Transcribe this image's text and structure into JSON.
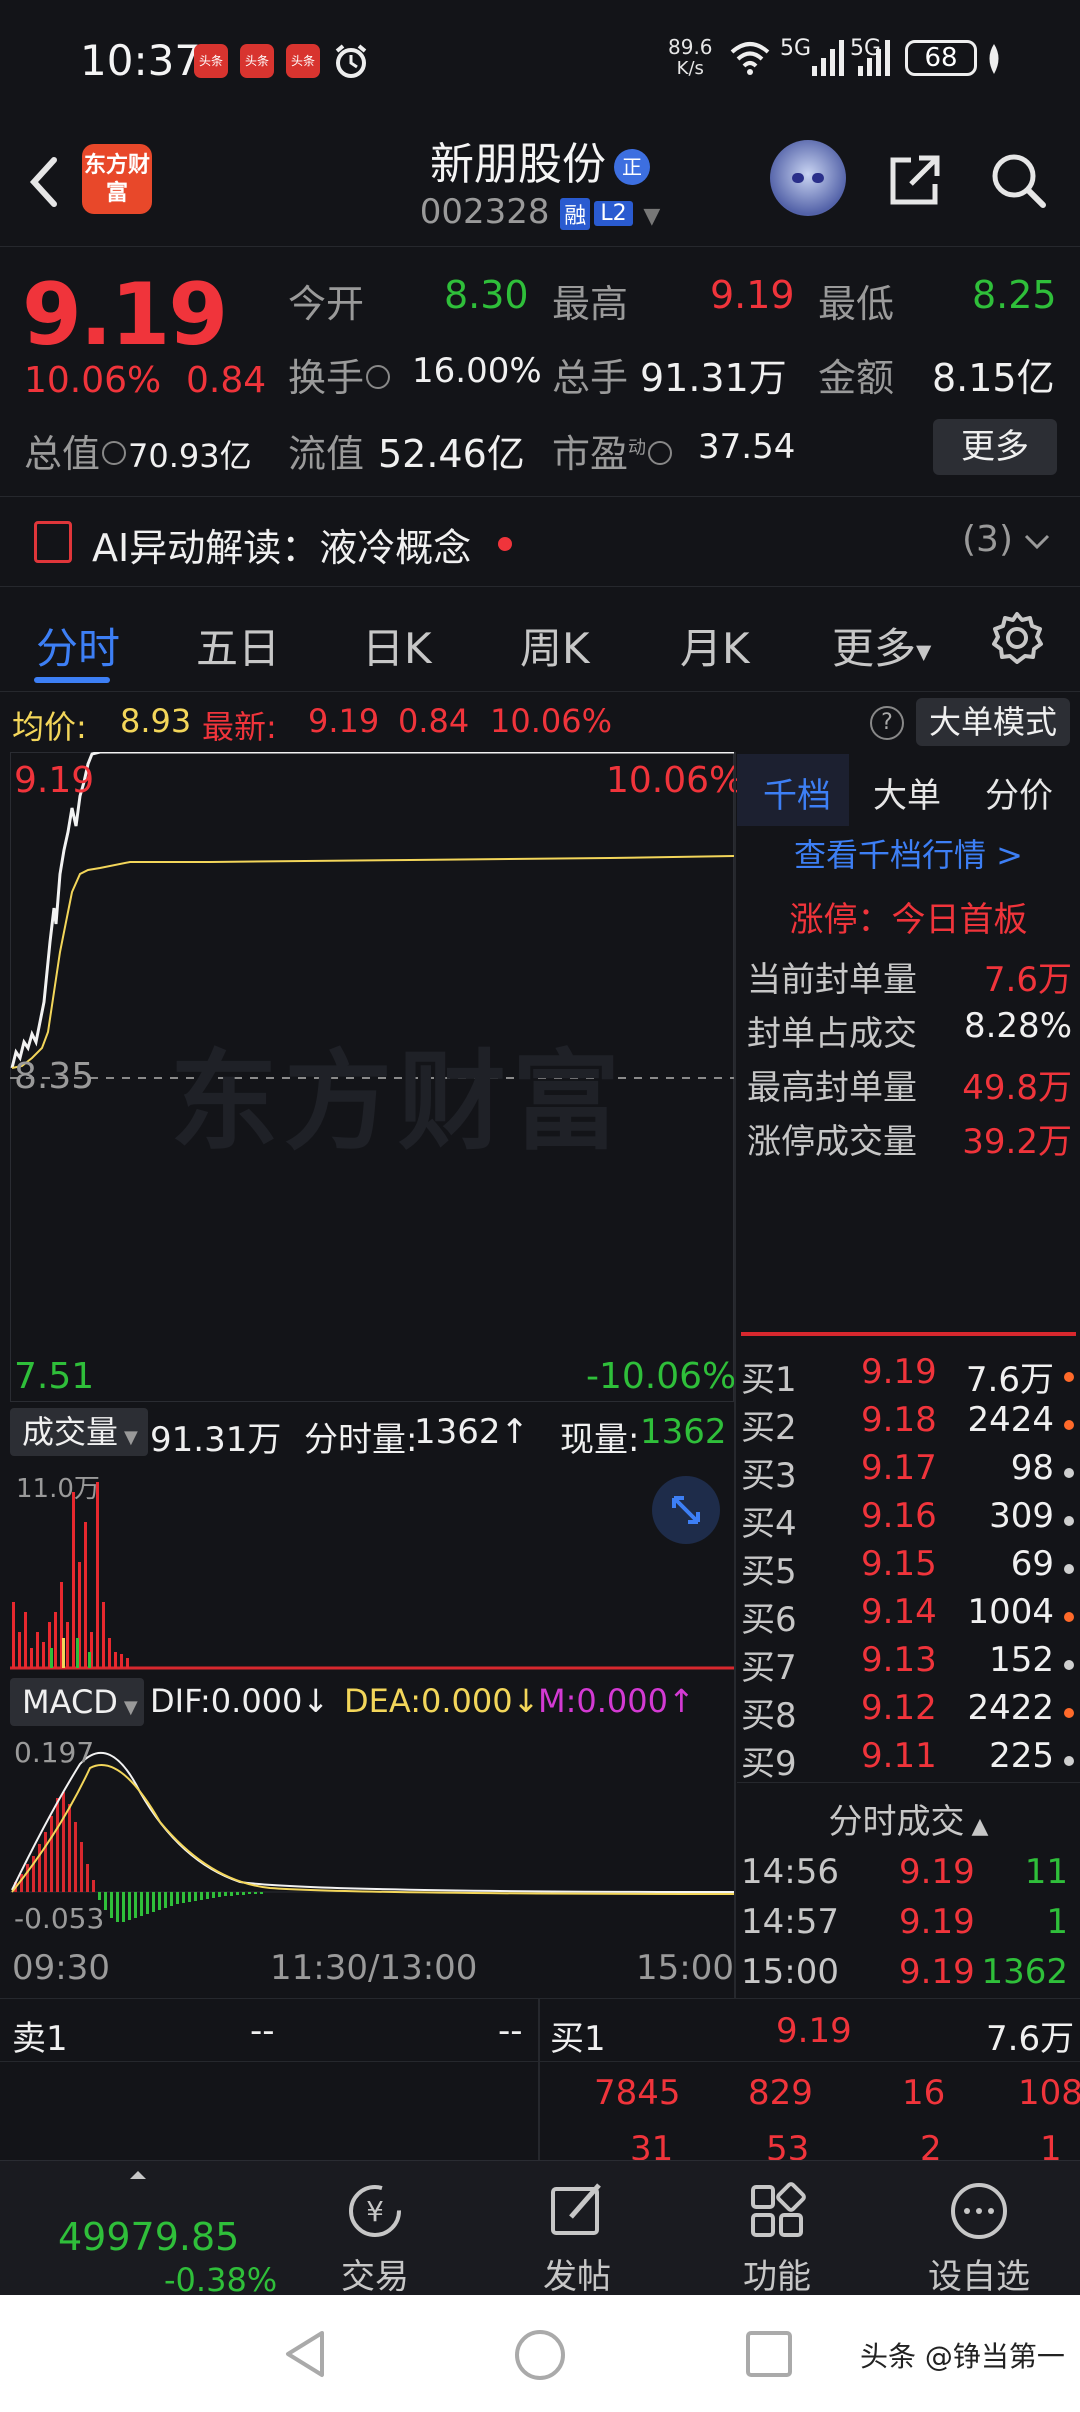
{
  "status_bar": {
    "time": "10:37",
    "app_icon_label": "头条",
    "net_speed": "89.6",
    "net_unit": "K/s",
    "signal1": "5G",
    "signal2": "5G",
    "battery": "68"
  },
  "header": {
    "logo_text": "东方财富",
    "stock_name": "新朋股份",
    "badge": "正",
    "stock_code": "002328",
    "tag_rong": "融",
    "tag_l2": "L2"
  },
  "quote": {
    "price": "9.19",
    "change_pct": "10.06%",
    "change": "0.84",
    "open_label": "今开",
    "open": "8.30",
    "high_label": "最高",
    "high": "9.19",
    "low_label": "最低",
    "low": "8.25",
    "turnover_label": "换手",
    "turnover": "16.00%",
    "volume_label": "总手",
    "volume": "91.31万",
    "amount_label": "金额",
    "amount": "8.15亿",
    "mktcap_label": "总值",
    "mktcap": "70.93亿",
    "float_label": "流值",
    "float": "52.46亿",
    "pe_label": "市盈",
    "pe_sup": "动",
    "pe": "37.54",
    "more": "更多"
  },
  "ai_row": {
    "text": "AI异动解读：液冷概念",
    "count": "(3)"
  },
  "tabs": [
    "分时",
    "五日",
    "日K",
    "周K",
    "月K",
    "更多"
  ],
  "info_line": {
    "avg_label": "均价:",
    "avg": "8.93",
    "latest_label": "最新:",
    "latest": "9.19",
    "chg": "0.84",
    "pct": "10.06%",
    "mode_btn": "大单模式"
  },
  "chart_labels": {
    "top_price": "9.19",
    "top_pct": "10.06%",
    "mid_price": "8.35",
    "bottom_price": "7.51",
    "bottom_pct": "-10.06%",
    "watermark": "东方财富"
  },
  "volume_head": {
    "selector": "成交量",
    "total": "91.31万",
    "fs_label": "分时量:",
    "fs": "1362",
    "cur_label": "现量:",
    "cur": "1362",
    "max_label": "11.0万"
  },
  "macd_head": {
    "selector": "MACD",
    "dif": "DIF:0.000",
    "dea": "DEA:0.000",
    "m": "M:0.000",
    "max_label": "0.197",
    "min_label": "-0.053"
  },
  "time_axis": [
    "09:30",
    "11:30/13:00",
    "15:00"
  ],
  "right_panel": {
    "tabs": [
      "千档",
      "大单",
      "分价"
    ],
    "link": "查看千档行情 >",
    "limit_title": "涨停：今日首板",
    "stats": [
      {
        "k": "当前封单量",
        "v": "7.6万",
        "color": "#f0343b"
      },
      {
        "k": "封单占成交",
        "v": "8.28%",
        "color": "#f0f0f0"
      },
      {
        "k": "最高封单量",
        "v": "49.8万",
        "color": "#f0343b"
      },
      {
        "k": "涨停成交量",
        "v": "39.2万",
        "color": "#f0343b"
      }
    ],
    "bids": [
      {
        "n": "买1",
        "p": "9.19",
        "q": "7.6万",
        "dot": "#ff6a2a"
      },
      {
        "n": "买2",
        "p": "9.18",
        "q": "2424",
        "dot": "#ff6a2a"
      },
      {
        "n": "买3",
        "p": "9.17",
        "q": "98",
        "dot": "#cfcfcf"
      },
      {
        "n": "买4",
        "p": "9.16",
        "q": "309",
        "dot": "#cfcfcf"
      },
      {
        "n": "买5",
        "p": "9.15",
        "q": "69",
        "dot": "#cfcfcf"
      },
      {
        "n": "买6",
        "p": "9.14",
        "q": "1004",
        "dot": "#ff6a2a"
      },
      {
        "n": "买7",
        "p": "9.13",
        "q": "152",
        "dot": "#cfcfcf"
      },
      {
        "n": "买8",
        "p": "9.12",
        "q": "2422",
        "dot": "#ff6a2a"
      },
      {
        "n": "买9",
        "p": "9.11",
        "q": "225",
        "dot": "#cfcfcf"
      }
    ],
    "trades_title": "分时成交",
    "trades": [
      {
        "t": "14:56",
        "p": "9.19",
        "v": "11"
      },
      {
        "t": "14:57",
        "p": "9.19",
        "v": "1"
      },
      {
        "t": "15:00",
        "p": "9.19",
        "v": "1362"
      }
    ]
  },
  "order_book": {
    "sell_label": "卖1",
    "sell_p": "--",
    "sell_q": "--",
    "buy_label": "买1",
    "buy_p": "9.19",
    "buy_q": "7.6万",
    "row1": [
      "7845",
      "829",
      "16",
      "108"
    ],
    "row2": [
      "31",
      "53",
      "2",
      "1"
    ]
  },
  "bottom_nav": {
    "index_value": "49979.85",
    "index_pct": "-0.38%",
    "items": [
      "交易",
      "发帖",
      "功能",
      "设自选"
    ]
  },
  "watermark_bottom": "头条 @铮当第一",
  "colors": {
    "up": "#f0343b",
    "down": "#2fbf3a",
    "accent": "#3d7ff5",
    "avg_line": "#f3d65a",
    "background": "#131418"
  }
}
